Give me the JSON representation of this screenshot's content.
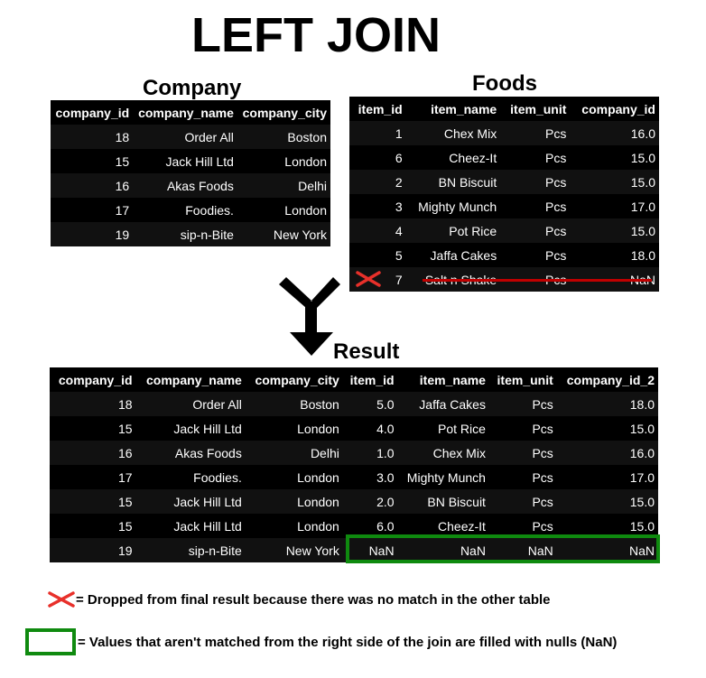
{
  "title": "LEFT JOIN",
  "company": {
    "caption": "Company",
    "columns": [
      "company_id",
      "company_name",
      "company_city"
    ],
    "rows": [
      [
        "18",
        "Order All",
        "Boston"
      ],
      [
        "15",
        "Jack Hill Ltd",
        "London"
      ],
      [
        "16",
        "Akas Foods",
        "Delhi"
      ],
      [
        "17",
        "Foodies.",
        "London"
      ],
      [
        "19",
        "sip-n-Bite",
        "New York"
      ]
    ]
  },
  "foods": {
    "caption": "Foods",
    "columns": [
      "item_id",
      "item_name",
      "item_unit",
      "company_id"
    ],
    "rows": [
      [
        "1",
        "Chex Mix",
        "Pcs",
        "16.0"
      ],
      [
        "6",
        "Cheez-It",
        "Pcs",
        "15.0"
      ],
      [
        "2",
        "BN Biscuit",
        "Pcs",
        "15.0"
      ],
      [
        "3",
        "Mighty Munch",
        "Pcs",
        "17.0"
      ],
      [
        "4",
        "Pot Rice",
        "Pcs",
        "15.0"
      ],
      [
        "5",
        "Jaffa Cakes",
        "Pcs",
        "18.0"
      ],
      [
        "7",
        "Salt n Shake",
        "Pcs",
        "NaN"
      ]
    ]
  },
  "result": {
    "caption": "Result",
    "columns": [
      "company_id",
      "company_name",
      "company_city",
      "item_id",
      "item_name",
      "item_unit",
      "company_id_2"
    ],
    "rows": [
      [
        "18",
        "Order All",
        "Boston",
        "5.0",
        "Jaffa Cakes",
        "Pcs",
        "18.0"
      ],
      [
        "15",
        "Jack Hill Ltd",
        "London",
        "4.0",
        "Pot Rice",
        "Pcs",
        "15.0"
      ],
      [
        "16",
        "Akas Foods",
        "Delhi",
        "1.0",
        "Chex Mix",
        "Pcs",
        "16.0"
      ],
      [
        "17",
        "Foodies.",
        "London",
        "3.0",
        "Mighty Munch",
        "Pcs",
        "17.0"
      ],
      [
        "15",
        "Jack Hill Ltd",
        "London",
        "2.0",
        "BN Biscuit",
        "Pcs",
        "15.0"
      ],
      [
        "15",
        "Jack Hill Ltd",
        "London",
        "6.0",
        "Cheez-It",
        "Pcs",
        "15.0"
      ],
      [
        "19",
        "sip-n-Bite",
        "New York",
        "NaN",
        "NaN",
        "NaN",
        "NaN"
      ]
    ]
  },
  "legend": {
    "dropped": "= Dropped from final result because there was no match in the other table",
    "nulls": "= Values that aren't matched from the right side of the join are filled with nulls (NaN)"
  },
  "colors": {
    "table_bg": "#000000",
    "row_alt": "#111111",
    "x_mark": "#e8302a",
    "strike": "#c00000",
    "highlight_box": "#0f8a0f"
  },
  "icons": {
    "dropped": "x-mark-icon",
    "merge": "merge-arrow-icon",
    "nulls": "green-box-icon"
  }
}
